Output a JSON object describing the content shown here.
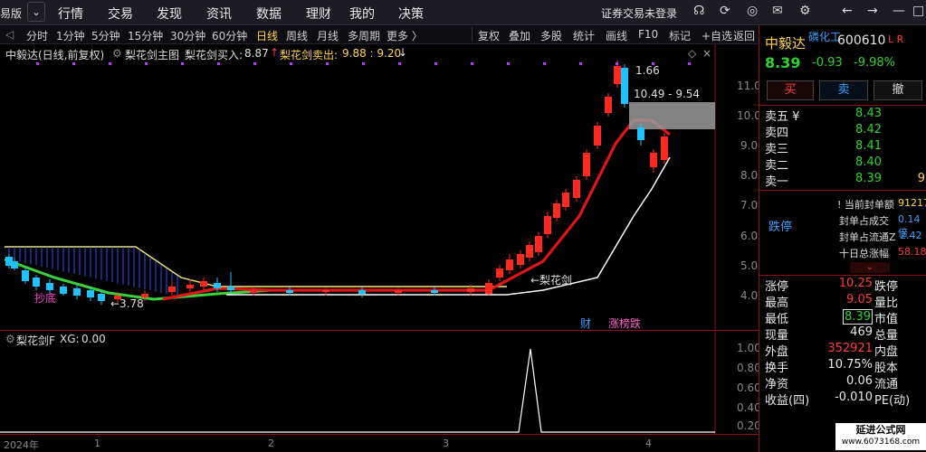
{
  "topbar": {
    "edition": "易版",
    "back": "⌄",
    "nav": [
      "行情",
      "交易",
      "发现",
      "资讯",
      "数据",
      "理财",
      "我的",
      "决策"
    ],
    "login": "证券交易未登录",
    "icons": [
      "headset-icon",
      "refresh-icon",
      "globe-icon",
      "mail-icon",
      "gear-icon",
      "back-arrow-icon",
      "forward-arrow-icon",
      "minimize-icon",
      "maximize-icon",
      "close-icon"
    ]
  },
  "toolbar": {
    "left_items": [
      "分时",
      "1分钟",
      "5分钟",
      "15分钟",
      "30分钟",
      "60分钟",
      "日线",
      "周线",
      "月线",
      "多周期",
      "更多 〉"
    ],
    "active": "日线",
    "right_items": [
      "复权",
      "叠加",
      "多股",
      "统计",
      "画线",
      "F10",
      "标记",
      "+自选",
      "返回"
    ]
  },
  "main": {
    "title": "中毅达(日线,前复权)",
    "indicator": "梨花剑主图",
    "buy_label": "梨花剑买入:",
    "buy_value": "8.87",
    "sell_label": "梨花剑卖出:",
    "sell_value": "9.88 : 9.20",
    "annotation_high": "1.66",
    "annotation_range": "10.49 - 9.54",
    "annotation_low": "←3.78",
    "annotation_pink": "抄底",
    "annotation_lhj": "←梨花剑",
    "badges": [
      "财",
      "涨榜跌"
    ],
    "y_ticks": [
      "11.00",
      "10.00",
      "9.00",
      "8.00",
      "7.00",
      "6.00",
      "5.00",
      "4.00"
    ],
    "colors": {
      "up": "#ff2a1f",
      "down": "#1fc2ff",
      "green": "#3ad23a",
      "yellow": "#f5e97a",
      "white": "#ffffff",
      "grid": "#8b1414"
    }
  },
  "sub": {
    "title": "梨花剑F",
    "xg_label": "XG:",
    "xg_value": "0.00",
    "y_ticks": [
      "1.00",
      "0.80",
      "0.60",
      "0.40",
      "0.20"
    ]
  },
  "bottom": {
    "x_ticks": [
      "2024年",
      "1",
      "2",
      "3",
      "4"
    ]
  },
  "right": {
    "name": "中毅达",
    "sector": "磷化工",
    "code": "600610",
    "tags": "L R",
    "price": "8.39",
    "change": "-0.93",
    "pct": "-9.98%",
    "buy_btn": "买",
    "sell_btn": "卖",
    "cancel_btn": "撤",
    "asks": [
      {
        "label": "卖五 ¥",
        "price": "8.43"
      },
      {
        "label": "卖四",
        "price": "8.42"
      },
      {
        "label": "卖三",
        "price": "8.41"
      },
      {
        "label": "卖二",
        "price": "8.40"
      },
      {
        "label": "卖一",
        "price": "8.39"
      }
    ],
    "limit_label": "跌停",
    "seal_rows": [
      {
        "label": "! 当前封单额",
        "value": "91217"
      },
      {
        "label": "封单占成交",
        "value": "0.14倍"
      },
      {
        "label": "封单占流通Z",
        "value": "2.42"
      },
      {
        "label": "十日总涨幅",
        "value": "58.18"
      }
    ],
    "stats": [
      {
        "l1": "涨停",
        "v1": "10.25",
        "l2": "跌停"
      },
      {
        "l1": "最高",
        "v1": "9.05",
        "l2": "量比"
      },
      {
        "l1": "最低",
        "v1": "8.39",
        "l2": "市值"
      },
      {
        "l1": "现量",
        "v1": "469",
        "l2": "总量"
      },
      {
        "l1": "外盘",
        "v1": "352921",
        "l2": "内盘"
      },
      {
        "l1": "换手",
        "v1": "10.75%",
        "l2": "股本"
      },
      {
        "l1": "净资",
        "v1": "0.06",
        "l2": "流通"
      },
      {
        "l1": "收益(四)",
        "v1": "-0.010",
        "l2": "PE(动)"
      }
    ],
    "watermark": "延进公式网",
    "watermark_url": "www.6073168.com"
  }
}
